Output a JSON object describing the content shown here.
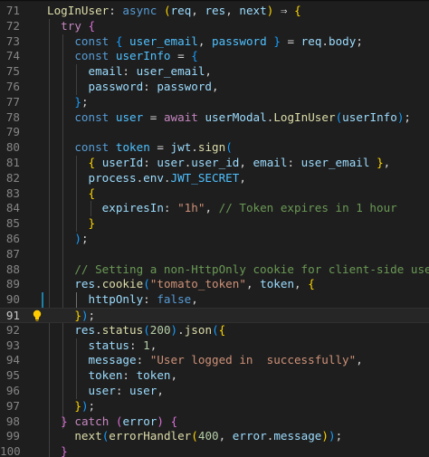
{
  "editor": {
    "current_line": 91,
    "lightbulb_icon": "lightbulb-icon",
    "lines": [
      {
        "n": "71",
        "tokens": [
          [
            "fn",
            "LogInUser"
          ],
          [
            "op",
            ": "
          ],
          [
            "st",
            "async"
          ],
          [
            "op",
            " "
          ],
          [
            "br1",
            "("
          ],
          [
            "var",
            "req"
          ],
          [
            "op",
            ", "
          ],
          [
            "var",
            "res"
          ],
          [
            "op",
            ", "
          ],
          [
            "var",
            "next"
          ],
          [
            "br1",
            ")"
          ],
          [
            "op",
            " ⇒ "
          ],
          [
            "br1",
            "{"
          ]
        ]
      },
      {
        "n": "72",
        "tokens": [
          [
            "op",
            "  "
          ],
          [
            "kw",
            "try"
          ],
          [
            "op",
            " "
          ],
          [
            "br2",
            "{"
          ]
        ]
      },
      {
        "n": "73",
        "tokens": [
          [
            "op",
            "    "
          ],
          [
            "st",
            "const"
          ],
          [
            "op",
            " "
          ],
          [
            "br3",
            "{"
          ],
          [
            "op",
            " "
          ],
          [
            "cst",
            "user_email"
          ],
          [
            "op",
            ", "
          ],
          [
            "cst",
            "password"
          ],
          [
            "op",
            " "
          ],
          [
            "br3",
            "}"
          ],
          [
            "op",
            " = "
          ],
          [
            "var",
            "req"
          ],
          [
            "op",
            "."
          ],
          [
            "prop",
            "body"
          ],
          [
            "op",
            ";"
          ]
        ]
      },
      {
        "n": "74",
        "tokens": [
          [
            "op",
            "    "
          ],
          [
            "st",
            "const"
          ],
          [
            "op",
            " "
          ],
          [
            "cst",
            "userInfo"
          ],
          [
            "op",
            " = "
          ],
          [
            "br3",
            "{"
          ]
        ]
      },
      {
        "n": "75",
        "tokens": [
          [
            "op",
            "      "
          ],
          [
            "prop",
            "email"
          ],
          [
            "op",
            ": "
          ],
          [
            "var",
            "user_email"
          ],
          [
            "op",
            ","
          ]
        ]
      },
      {
        "n": "76",
        "tokens": [
          [
            "op",
            "      "
          ],
          [
            "prop",
            "password"
          ],
          [
            "op",
            ": "
          ],
          [
            "var",
            "password"
          ],
          [
            "op",
            ","
          ]
        ]
      },
      {
        "n": "77",
        "tokens": [
          [
            "op",
            "    "
          ],
          [
            "br3",
            "}"
          ],
          [
            "op",
            ";"
          ]
        ]
      },
      {
        "n": "78",
        "tokens": [
          [
            "op",
            "    "
          ],
          [
            "st",
            "const"
          ],
          [
            "op",
            " "
          ],
          [
            "cst",
            "user"
          ],
          [
            "op",
            " = "
          ],
          [
            "kw",
            "await"
          ],
          [
            "op",
            " "
          ],
          [
            "var",
            "userModal"
          ],
          [
            "op",
            "."
          ],
          [
            "fn",
            "LogInUser"
          ],
          [
            "br3",
            "("
          ],
          [
            "var",
            "userInfo"
          ],
          [
            "br3",
            ")"
          ],
          [
            "op",
            ";"
          ]
        ]
      },
      {
        "n": "79",
        "tokens": []
      },
      {
        "n": "80",
        "tokens": [
          [
            "op",
            "    "
          ],
          [
            "st",
            "const"
          ],
          [
            "op",
            " "
          ],
          [
            "cst",
            "token"
          ],
          [
            "op",
            " = "
          ],
          [
            "var",
            "jwt"
          ],
          [
            "op",
            "."
          ],
          [
            "fn",
            "sign"
          ],
          [
            "br3",
            "("
          ]
        ]
      },
      {
        "n": "81",
        "tokens": [
          [
            "op",
            "      "
          ],
          [
            "br1",
            "{"
          ],
          [
            "op",
            " "
          ],
          [
            "prop",
            "userId"
          ],
          [
            "op",
            ": "
          ],
          [
            "var",
            "user"
          ],
          [
            "op",
            "."
          ],
          [
            "prop",
            "user_id"
          ],
          [
            "op",
            ", "
          ],
          [
            "prop",
            "email"
          ],
          [
            "op",
            ": "
          ],
          [
            "var",
            "user_email"
          ],
          [
            "op",
            " "
          ],
          [
            "br1",
            "}"
          ],
          [
            "op",
            ","
          ]
        ]
      },
      {
        "n": "82",
        "tokens": [
          [
            "op",
            "      "
          ],
          [
            "var",
            "process"
          ],
          [
            "op",
            "."
          ],
          [
            "prop",
            "env"
          ],
          [
            "op",
            "."
          ],
          [
            "cst",
            "JWT_SECRET"
          ],
          [
            "op",
            ","
          ]
        ]
      },
      {
        "n": "83",
        "tokens": [
          [
            "op",
            "      "
          ],
          [
            "br1",
            "{"
          ]
        ]
      },
      {
        "n": "84",
        "tokens": [
          [
            "op",
            "        "
          ],
          [
            "prop",
            "expiresIn"
          ],
          [
            "op",
            ": "
          ],
          [
            "str",
            "\"1h\""
          ],
          [
            "op",
            ", "
          ],
          [
            "cmt",
            "// Token expires in 1 hour"
          ]
        ]
      },
      {
        "n": "85",
        "tokens": [
          [
            "op",
            "      "
          ],
          [
            "br1",
            "}"
          ]
        ]
      },
      {
        "n": "86",
        "tokens": [
          [
            "op",
            "    "
          ],
          [
            "br3",
            ")"
          ],
          [
            "op",
            ";"
          ]
        ]
      },
      {
        "n": "87",
        "tokens": []
      },
      {
        "n": "88",
        "tokens": [
          [
            "op",
            "    "
          ],
          [
            "cmt",
            "// Setting a non-HttpOnly cookie for client-side use"
          ]
        ]
      },
      {
        "n": "89",
        "tokens": [
          [
            "op",
            "    "
          ],
          [
            "var",
            "res"
          ],
          [
            "op",
            "."
          ],
          [
            "fn",
            "cookie"
          ],
          [
            "br3",
            "("
          ],
          [
            "str",
            "\"tomato_token\""
          ],
          [
            "op",
            ", "
          ],
          [
            "var",
            "token"
          ],
          [
            "op",
            ", "
          ],
          [
            "br1",
            "{"
          ]
        ]
      },
      {
        "n": "90",
        "tokens": [
          [
            "op",
            "      "
          ],
          [
            "prop",
            "httpOnly"
          ],
          [
            "op",
            ": "
          ],
          [
            "st",
            "false"
          ],
          [
            "op",
            ","
          ]
        ]
      },
      {
        "n": "91",
        "tokens": [
          [
            "op",
            "    "
          ],
          [
            "br1",
            "}"
          ],
          [
            "br3",
            ")"
          ],
          [
            "op",
            ";"
          ]
        ]
      },
      {
        "n": "92",
        "tokens": [
          [
            "op",
            "    "
          ],
          [
            "var",
            "res"
          ],
          [
            "op",
            "."
          ],
          [
            "fn",
            "status"
          ],
          [
            "br3",
            "("
          ],
          [
            "num",
            "200"
          ],
          [
            "br3",
            ")"
          ],
          [
            "op",
            "."
          ],
          [
            "fn",
            "json"
          ],
          [
            "br3",
            "("
          ],
          [
            "br1",
            "{"
          ]
        ]
      },
      {
        "n": "93",
        "tokens": [
          [
            "op",
            "      "
          ],
          [
            "prop",
            "status"
          ],
          [
            "op",
            ": "
          ],
          [
            "num",
            "1"
          ],
          [
            "op",
            ","
          ]
        ]
      },
      {
        "n": "94",
        "tokens": [
          [
            "op",
            "      "
          ],
          [
            "prop",
            "message"
          ],
          [
            "op",
            ": "
          ],
          [
            "str",
            "\"User logged in  successfully\""
          ],
          [
            "op",
            ","
          ]
        ]
      },
      {
        "n": "95",
        "tokens": [
          [
            "op",
            "      "
          ],
          [
            "prop",
            "token"
          ],
          [
            "op",
            ": "
          ],
          [
            "var",
            "token"
          ],
          [
            "op",
            ","
          ]
        ]
      },
      {
        "n": "96",
        "tokens": [
          [
            "op",
            "      "
          ],
          [
            "prop",
            "user"
          ],
          [
            "op",
            ": "
          ],
          [
            "var",
            "user"
          ],
          [
            "op",
            ","
          ]
        ]
      },
      {
        "n": "97",
        "tokens": [
          [
            "op",
            "    "
          ],
          [
            "br1",
            "}"
          ],
          [
            "br3",
            ")"
          ],
          [
            "op",
            ";"
          ]
        ]
      },
      {
        "n": "98",
        "tokens": [
          [
            "op",
            "  "
          ],
          [
            "br2",
            "}"
          ],
          [
            "op",
            " "
          ],
          [
            "kw",
            "catch"
          ],
          [
            "op",
            " "
          ],
          [
            "br2",
            "("
          ],
          [
            "var",
            "error"
          ],
          [
            "br2",
            ")"
          ],
          [
            "op",
            " "
          ],
          [
            "br2",
            "{"
          ]
        ]
      },
      {
        "n": "99",
        "tokens": [
          [
            "op",
            "    "
          ],
          [
            "fn",
            "next"
          ],
          [
            "br3",
            "("
          ],
          [
            "fn",
            "errorHandler"
          ],
          [
            "br1",
            "("
          ],
          [
            "num",
            "400"
          ],
          [
            "op",
            ", "
          ],
          [
            "var",
            "error"
          ],
          [
            "op",
            "."
          ],
          [
            "prop",
            "message"
          ],
          [
            "br1",
            ")"
          ],
          [
            "br3",
            ")"
          ],
          [
            "op",
            ";"
          ]
        ]
      },
      {
        "n": "100",
        "tokens": [
          [
            "op",
            "  "
          ],
          [
            "br2",
            "}"
          ]
        ]
      }
    ]
  }
}
